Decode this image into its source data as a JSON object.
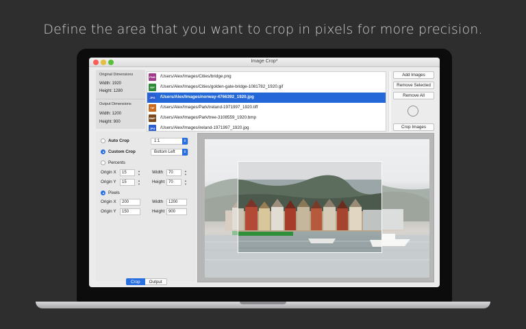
{
  "headline": "Define the area that you want to crop in pixels for more precision.",
  "window": {
    "title": "Image Crop*"
  },
  "dimensions": {
    "original_heading": "Original Dimensions",
    "original_width": "Width: 1920",
    "original_height": "Height: 1280",
    "output_heading": "Output Dimensions",
    "output_width": "Width: 1200",
    "output_height": "Height: 900"
  },
  "files": [
    {
      "badge": "PNG",
      "color": "#a23a8c",
      "path": "/Users/Alex/Images/Cities/bridge.png"
    },
    {
      "badge": "GIF",
      "color": "#2f8c3a",
      "path": "/Users/Alex/Images/Cities/golden-gate-bridge-1081782_1920.gif"
    },
    {
      "badge": "JPG",
      "color": "#2a5ed1",
      "path": "/Users/Alex/Images/norway-4766392_1920.jpg"
    },
    {
      "badge": "TIF",
      "color": "#c86b1f",
      "path": "/Users/Alex/Images/Park/ireland-1971997_1920.tiff"
    },
    {
      "badge": "BMP",
      "color": "#7a4a1c",
      "path": "/Users/Alex/Images/Park/tree-3108559_1920.bmp"
    },
    {
      "badge": "JPG",
      "color": "#2a5ed1",
      "path": "/Users/Alex/Images/ireland-1971997_1920.jpg"
    }
  ],
  "selected_file_index": 2,
  "buttons": {
    "add": "Add Images",
    "remove_selected": "Remove Selected",
    "remove_all": "Remove All",
    "crop": "Crop Images"
  },
  "options": {
    "auto_crop": "Auto Crop",
    "ratio": "1:1",
    "custom_crop": "Custom Crop",
    "anchor": "Bottom Left",
    "percents": "Percents",
    "pixels": "Pixels",
    "origin_x_label": "Origin X",
    "origin_y_label": "Origin Y",
    "width_label": "Width",
    "height_label": "Height",
    "pct_origin_x": "15",
    "pct_origin_y": "15",
    "pct_width": "70",
    "pct_height": "70",
    "px_origin_x": "200",
    "px_origin_y": "150",
    "px_width": "1200",
    "px_height": "900"
  },
  "tabs": {
    "crop": "Crop",
    "output": "Output"
  }
}
